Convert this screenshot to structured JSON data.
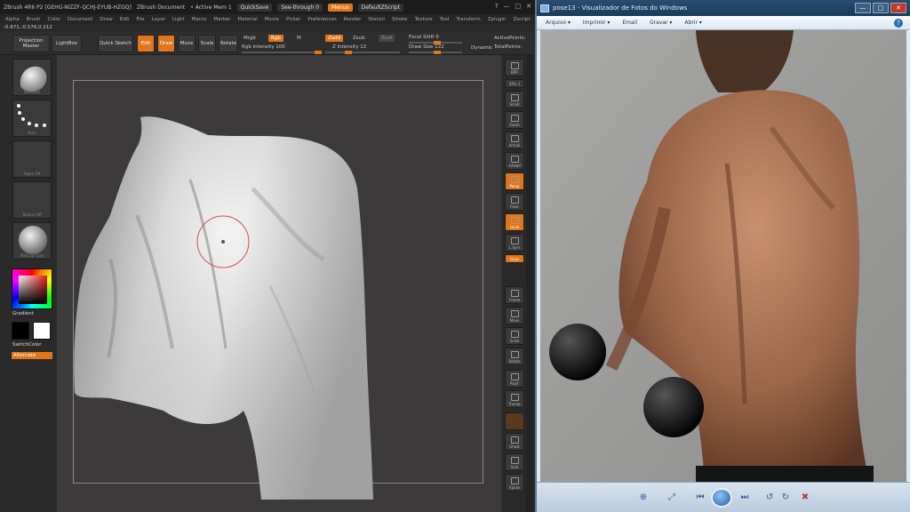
{
  "zbrush": {
    "title_segments": [
      "ZBrush 4R6  P2 [GEHG-WZZF-QCHJ-EYUB-HZGQ]",
      "ZBrush Document",
      "• Active Mem 1",
      "QuickSave",
      "See-through  0",
      "Menus",
      "DefaultZScript"
    ],
    "window_buttons": [
      "?",
      "—",
      "□",
      "✕"
    ],
    "menus": [
      "Alpha",
      "Brush",
      "Color",
      "Document",
      "Draw",
      "Edit",
      "File",
      "Layer",
      "Light",
      "Macro",
      "Marker",
      "Material",
      "Movie",
      "Picker",
      "Preferences",
      "Render",
      "Stencil",
      "Stroke",
      "Texture",
      "Tool",
      "Transform",
      "Zplugin",
      "Zscript"
    ],
    "coords": "-0.871,-0.576,0.212",
    "shelf": {
      "projection_master": "Projection Master",
      "lightbox": "LightBox",
      "quick_sketch": "Quick Sketch",
      "edit": "Edit",
      "draw": "Draw",
      "move": "Move",
      "scale": "Scale",
      "rotate": "Rotate",
      "mrgb": "Mrgb",
      "rgb": "Rgb",
      "m": "M",
      "zadd": "Zadd",
      "zsub": "Zsub",
      "zcut": "Zcut",
      "rgb_intensity": "Rgb  Intensity 100",
      "z_intensity": "Z Intensity 12",
      "focal_shift": "Focal Shift 0",
      "draw_size": "Draw Size 122",
      "dynamic": "Dynamic",
      "active_points": "ActivePoints:",
      "total_points": "TotalPoints:"
    },
    "left": {
      "thumb_captions": [
        "Standard",
        "Dots",
        "Alpha Off",
        "Texture Off",
        "MatCap Gray"
      ],
      "gradient": "Gradient",
      "switch_color": "SwitchColor",
      "alternate": "Alternate"
    },
    "right_buttons": [
      "BPR",
      "SPix 3",
      "Scroll",
      "Zoom",
      "Actual",
      "AAHalf",
      "Persp",
      "Floor",
      "Local",
      "L.Sym",
      "Gxyz",
      "Frame",
      "Move",
      "Scale",
      "Rotate",
      "PolyF",
      "Transp",
      "",
      "Ghost",
      "Solo",
      "Xpose"
    ],
    "colors": {
      "accent": "#e0761c",
      "canvas": "#3c3a3b",
      "panel": "#2a2a2a"
    }
  },
  "viewer": {
    "title": "pose13 - Visualizador de Fotos do Windows",
    "menu": [
      "Arquivo ▾",
      "Imprimir ▾",
      "Email",
      "Gravar ▾",
      "Abrir ▾"
    ],
    "help": "?",
    "window_buttons": [
      "—",
      "□",
      "✕"
    ],
    "toolbar_icons": [
      "zoom-icon",
      "fit-icon",
      "previous-icon",
      "play-slideshow-icon",
      "next-icon",
      "rotate-left-icon",
      "rotate-right-icon",
      "delete-icon"
    ]
  }
}
